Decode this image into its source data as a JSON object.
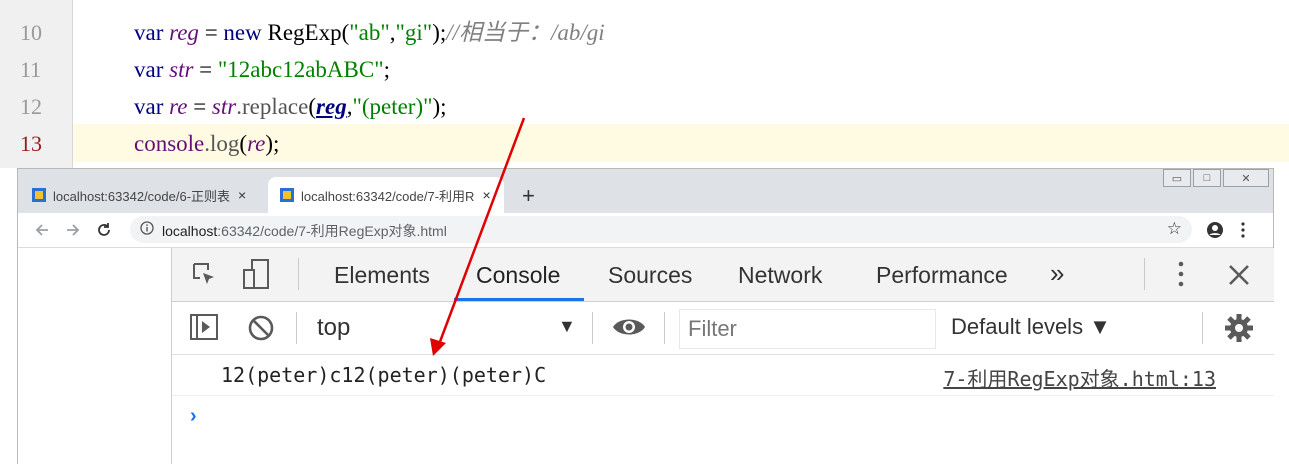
{
  "editor": {
    "line_numbers": [
      "10",
      "11",
      "12",
      "13"
    ],
    "line10": {
      "kw": "var ",
      "name": "reg",
      "op": " = ",
      "kw2": "new ",
      "cls": "RegExp(",
      "s1": "\"ab\"",
      "comma": ",",
      "s2": "\"gi\"",
      "close": ");",
      "comment": "//相当于：/ab/gi"
    },
    "line11": {
      "kw": "var ",
      "name": "str",
      "op": " = ",
      "s": "\"12abc12abABC\"",
      "end": ";"
    },
    "line12": {
      "kw": "var ",
      "name": "re",
      "op": " = ",
      "obj": "str",
      "dot": ".",
      "fn": "replace",
      "open": "(",
      "arg": "reg",
      "comma": ",",
      "s": "\"(peter)\"",
      "close": ");"
    },
    "line13": {
      "obj": "console",
      "dot": ".",
      "fn": "log",
      "open": "(",
      "arg": "re",
      "close": ");"
    }
  },
  "browser": {
    "tabs": [
      {
        "title": "localhost:63342/code/6-正则表",
        "close": "×"
      },
      {
        "title": "localhost:63342/code/7-利用R",
        "close": "×"
      }
    ],
    "new_tab": "+",
    "window_controls": [
      "▭",
      "□",
      "✕"
    ],
    "address": {
      "host": "localhost",
      "path": ":63342/code/7-利用RegExp对象.html"
    },
    "icons": {
      "back": "arrow-left-icon",
      "forward": "arrow-right-icon",
      "reload": "reload-icon",
      "info": "info-icon",
      "star": "star-icon",
      "profile": "profile-icon",
      "menu": "kebab-menu-icon"
    }
  },
  "devtools": {
    "tabs": [
      "Elements",
      "Console",
      "Sources",
      "Network",
      "Performance"
    ],
    "more": "»",
    "active_tab": "Console",
    "context": "top",
    "filter_placeholder": "Filter",
    "levels": "Default levels ▼",
    "log": {
      "text": "12(peter)c12(peter)(peter)C",
      "source": "7-利用RegExp对象.html:13"
    },
    "prompt": "›",
    "accent": "#1a73e8"
  },
  "annotation": {
    "arrow_color": "#e00000"
  }
}
